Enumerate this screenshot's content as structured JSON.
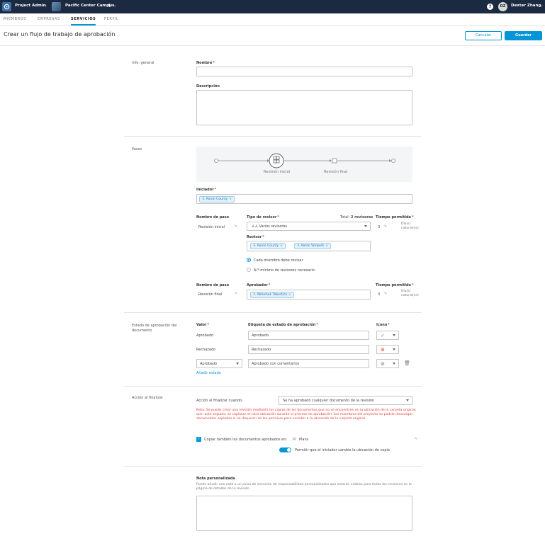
{
  "topbar": {
    "app_title": "Project Admin",
    "project_name": "Pacific Center Campus",
    "user_initials": "DZ",
    "user_name": "Dexter Zhang"
  },
  "tabs": [
    "MIEMBROS",
    "EMPRESAS",
    "SERVICIOS",
    "PERFIL"
  ],
  "header": {
    "title": "Crear un flujo de trabajo de aprobación",
    "cancel_label": "Cancelar",
    "save_label": "Guardar"
  },
  "general": {
    "section_label": "Info. general",
    "name_label": "Nombre",
    "name_value": "",
    "description_label": "Descripción",
    "description_value": ""
  },
  "steps": {
    "section_label": "Pasos",
    "diagram_initial": "Revisión inicial",
    "diagram_final": "Revisión final",
    "initiator_label": "Iniciador",
    "initiator_chips": [
      "Aaron County"
    ],
    "col_step_name": "Nombre de paso",
    "col_reviewer_type": "Tipo de revisor",
    "total_reviewers": "Total: 2 revisores",
    "col_time_allowed": "Tiempo permitido",
    "step1_name": "Revisión inicial",
    "step1_reviewer_type": "Varios revisores",
    "reviewer_label": "Revisor",
    "reviewer_chips": [
      "Aaron County",
      "Aaron Vorwerk"
    ],
    "option_each": "Cada miembro debe revisar",
    "option_min": "N.º mínimo de revisores necesario",
    "step1_days": "3",
    "step1_days_unit": "Día(s) natural(es)",
    "approver_label": "Aprobador",
    "step2_name": "Revisión final",
    "approver_chips": [
      "Abhishek Tabertica"
    ],
    "step2_days": "3",
    "step2_days_unit": "Día(s) natural(es)"
  },
  "status": {
    "section_label": "Estado de aprobación del documento",
    "col_value": "Valor",
    "col_label": "Etiqueta de estado de aprobación",
    "col_icon": "Icono",
    "rows": [
      {
        "value": "Aprobado",
        "label": "Aprobado"
      },
      {
        "value": "Rechazado",
        "label": "Rechazado"
      },
      {
        "value": "Aprobado",
        "label": "Aprobado con comentarios"
      }
    ],
    "add_state": "Añadir estado"
  },
  "finish": {
    "section_label": "Acción al finalizar",
    "when_label": "Acción al finalizar cuando:",
    "when_value": "Se ha aprobado cualquier documento de la revisión",
    "note": "Nota: Se puede crear una revisión mediante las copias de los documentos que no se encuentren en la ubicación de la carpeta original, que, acto seguido, se copiaran en otra ubicación durante el proceso de aprobación. Los miembros del proyecto no podrán descargar documentos copiados si no disponen de los permisos para acceder a la ubicación de la carpeta original.",
    "copy_label": "Copiar también los documentos aprobados en:",
    "copy_folder": "Plans",
    "toggle_label": "Permitir que el iniciador cambie la ubicación de copia"
  },
  "custom_note": {
    "label": "Nota personalizada",
    "help": "Puede añadir una nota o un aviso de exención de responsabilidad personalizados que estarán visibles para todos los revisores en la página de detalles de la revisión.",
    "value": ""
  },
  "colors": {
    "accent": "#0696d7",
    "topbar": "#1b2a41",
    "error": "#e23d3d",
    "approved": "#3aa655",
    "rejected": "#e23d3d"
  }
}
